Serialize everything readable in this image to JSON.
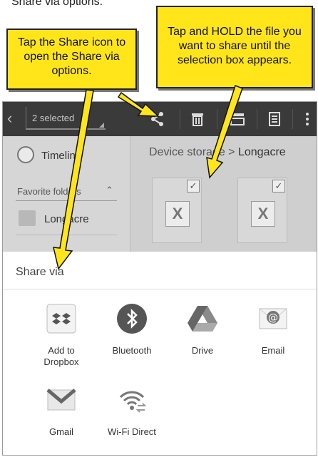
{
  "top_caption": "Share via options.",
  "callout_share": "Tap the Share icon to open the Share via options.",
  "callout_hold": "Tap and HOLD the file you want to share until the selection box appears.",
  "action_bar": {
    "back_icon": "back-chevron-icon",
    "selected_label": "2 selected",
    "icons": [
      "share-icon",
      "delete-icon",
      "move-icon",
      "copy-icon",
      "overflow-menu-icon"
    ]
  },
  "sidebar": {
    "timeline_label": "Timeline",
    "favorites_header": "Favorite folders",
    "folder_label": "Longacre"
  },
  "main": {
    "breadcrumb_root": "Device storage",
    "breadcrumb_separator": ">",
    "breadcrumb_current": "Longacre",
    "checked": "✓"
  },
  "share_sheet": {
    "title": "Share via",
    "apps": [
      {
        "label": "Add to Dropbox",
        "icon": "dropbox-icon"
      },
      {
        "label": "Bluetooth",
        "icon": "bluetooth-icon"
      },
      {
        "label": "Drive",
        "icon": "drive-icon"
      },
      {
        "label": "Email",
        "icon": "email-icon"
      },
      {
        "label": "Gmail",
        "icon": "gmail-icon"
      },
      {
        "label": "Wi-Fi Direct",
        "icon": "wifi-direct-icon"
      }
    ]
  },
  "colors": {
    "callout_fill": "#ffe51a",
    "action_bar": "#3a3a3a",
    "arrow_fill": "#ffe51a"
  }
}
